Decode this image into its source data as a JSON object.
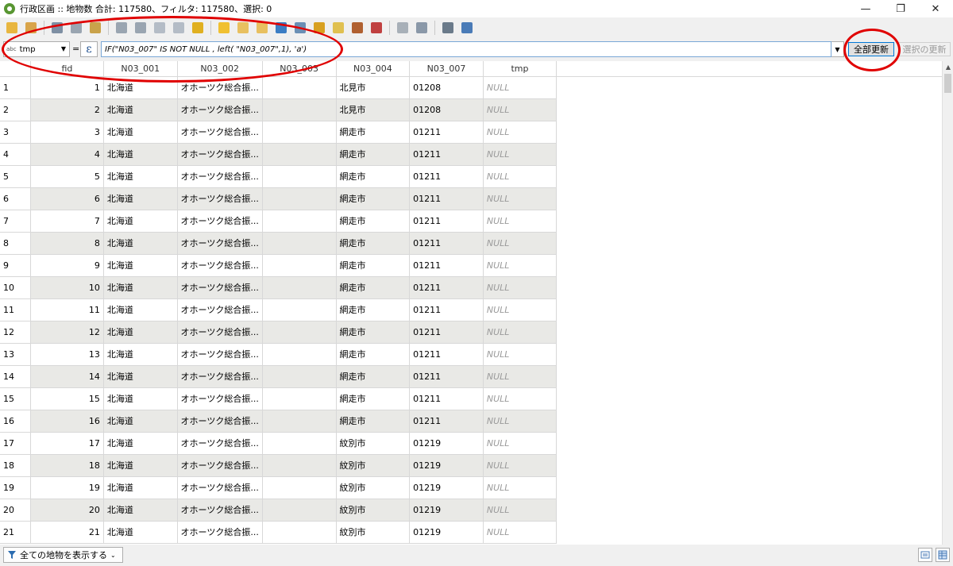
{
  "window": {
    "title": "行政区画 :: 地物数 合計: 117580、フィルタ: 117580、選択: 0",
    "minimize": "—",
    "restore": "❐",
    "close": "✕"
  },
  "toolbar": {
    "icons": [
      "edit-pencil-icon",
      "multi-edit-icon",
      "save-edits-icon",
      "reload-icon",
      "add-feature-icon",
      "delete-feature-icon",
      "cut-icon",
      "copy-icon",
      "paste-icon",
      "select-by-expression-icon",
      "select-all-icon",
      "invert-selection-icon",
      "deselect-icon",
      "filter-select-icon",
      "move-selection-top-icon",
      "pan-to-selected-icon",
      "zoom-to-selected-icon",
      "new-field-icon",
      "delete-field-icon",
      "field-calculator-icon",
      "conditional-format-icon",
      "actions-icon",
      "dock-icon"
    ]
  },
  "calc": {
    "field_type": "abc",
    "field_name": "tmp",
    "equals": "=",
    "expression_symbol": "ε",
    "expression": "IF(\"N03_007\" IS NOT NULL , left( \"N03_007\",1), 'a')",
    "update_all_label": "全部更新",
    "update_selected_label": "選択の更新"
  },
  "table": {
    "columns": [
      "fid",
      "N03_001",
      "N03_002",
      "N03_003",
      "N03_004",
      "N03_007",
      "tmp"
    ],
    "rows": [
      [
        "1",
        "1",
        "北海道",
        "オホーツク総合振...",
        "",
        "北見市",
        "01208",
        "NULL"
      ],
      [
        "2",
        "2",
        "北海道",
        "オホーツク総合振...",
        "",
        "北見市",
        "01208",
        "NULL"
      ],
      [
        "3",
        "3",
        "北海道",
        "オホーツク総合振...",
        "",
        "網走市",
        "01211",
        "NULL"
      ],
      [
        "4",
        "4",
        "北海道",
        "オホーツク総合振...",
        "",
        "網走市",
        "01211",
        "NULL"
      ],
      [
        "5",
        "5",
        "北海道",
        "オホーツク総合振...",
        "",
        "網走市",
        "01211",
        "NULL"
      ],
      [
        "6",
        "6",
        "北海道",
        "オホーツク総合振...",
        "",
        "網走市",
        "01211",
        "NULL"
      ],
      [
        "7",
        "7",
        "北海道",
        "オホーツク総合振...",
        "",
        "網走市",
        "01211",
        "NULL"
      ],
      [
        "8",
        "8",
        "北海道",
        "オホーツク総合振...",
        "",
        "網走市",
        "01211",
        "NULL"
      ],
      [
        "9",
        "9",
        "北海道",
        "オホーツク総合振...",
        "",
        "網走市",
        "01211",
        "NULL"
      ],
      [
        "10",
        "10",
        "北海道",
        "オホーツク総合振...",
        "",
        "網走市",
        "01211",
        "NULL"
      ],
      [
        "11",
        "11",
        "北海道",
        "オホーツク総合振...",
        "",
        "網走市",
        "01211",
        "NULL"
      ],
      [
        "12",
        "12",
        "北海道",
        "オホーツク総合振...",
        "",
        "網走市",
        "01211",
        "NULL"
      ],
      [
        "13",
        "13",
        "北海道",
        "オホーツク総合振...",
        "",
        "網走市",
        "01211",
        "NULL"
      ],
      [
        "14",
        "14",
        "北海道",
        "オホーツク総合振...",
        "",
        "網走市",
        "01211",
        "NULL"
      ],
      [
        "15",
        "15",
        "北海道",
        "オホーツク総合振...",
        "",
        "網走市",
        "01211",
        "NULL"
      ],
      [
        "16",
        "16",
        "北海道",
        "オホーツク総合振...",
        "",
        "網走市",
        "01211",
        "NULL"
      ],
      [
        "17",
        "17",
        "北海道",
        "オホーツク総合振...",
        "",
        "紋別市",
        "01219",
        "NULL"
      ],
      [
        "18",
        "18",
        "北海道",
        "オホーツク総合振...",
        "",
        "紋別市",
        "01219",
        "NULL"
      ],
      [
        "19",
        "19",
        "北海道",
        "オホーツク総合振...",
        "",
        "紋別市",
        "01219",
        "NULL"
      ],
      [
        "20",
        "20",
        "北海道",
        "オホーツク総合振...",
        "",
        "紋別市",
        "01219",
        "NULL"
      ],
      [
        "21",
        "21",
        "北海道",
        "オホーツク総合振...",
        "",
        "紋別市",
        "01219",
        "NULL"
      ]
    ]
  },
  "status": {
    "filter_label": "全ての地物を表示する"
  },
  "colors": {
    "annotation": "#e00000",
    "alt_row": "#e9e9e6",
    "qgis_green": "#589632"
  }
}
